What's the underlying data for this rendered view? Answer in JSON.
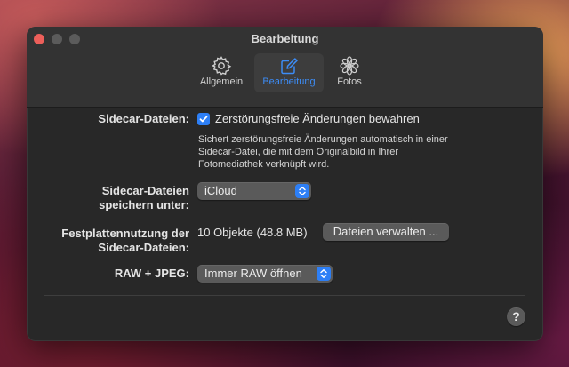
{
  "window": {
    "title": "Bearbeitung"
  },
  "tabs": [
    {
      "label": "Allgemein",
      "icon": "gear-icon",
      "active": false
    },
    {
      "label": "Bearbeitung",
      "icon": "edit-icon",
      "active": true
    },
    {
      "label": "Fotos",
      "icon": "photos-icon",
      "active": false
    }
  ],
  "sidecar": {
    "label": "Sidecar-Dateien:",
    "checkbox_label": "Zerstörungsfreie Änderungen bewahren",
    "checked": true,
    "description": "Sichert zerstörungsfreie Änderungen automatisch in einer Sidecar-Datei, die mit dem Originalbild in Ihrer Fotomediathek verknüpft wird."
  },
  "save_location": {
    "label_line1": "Sidecar-Dateien",
    "label_line2": "speichern unter:",
    "selected": "iCloud"
  },
  "disk_usage": {
    "label_line1": "Festplattennutzung der",
    "label_line2": "Sidecar-Dateien:",
    "value": "10 Objekte (48.8 MB)",
    "manage_button": "Dateien verwalten ..."
  },
  "raw_jpeg": {
    "label": "RAW + JPEG:",
    "selected": "Immer RAW öffnen"
  },
  "help": {
    "label": "?"
  },
  "colors": {
    "accent": "#2d7ff6",
    "active_tab_text": "#3d8cf5",
    "close": "#ec5f5a",
    "window_bg": "#282828"
  }
}
